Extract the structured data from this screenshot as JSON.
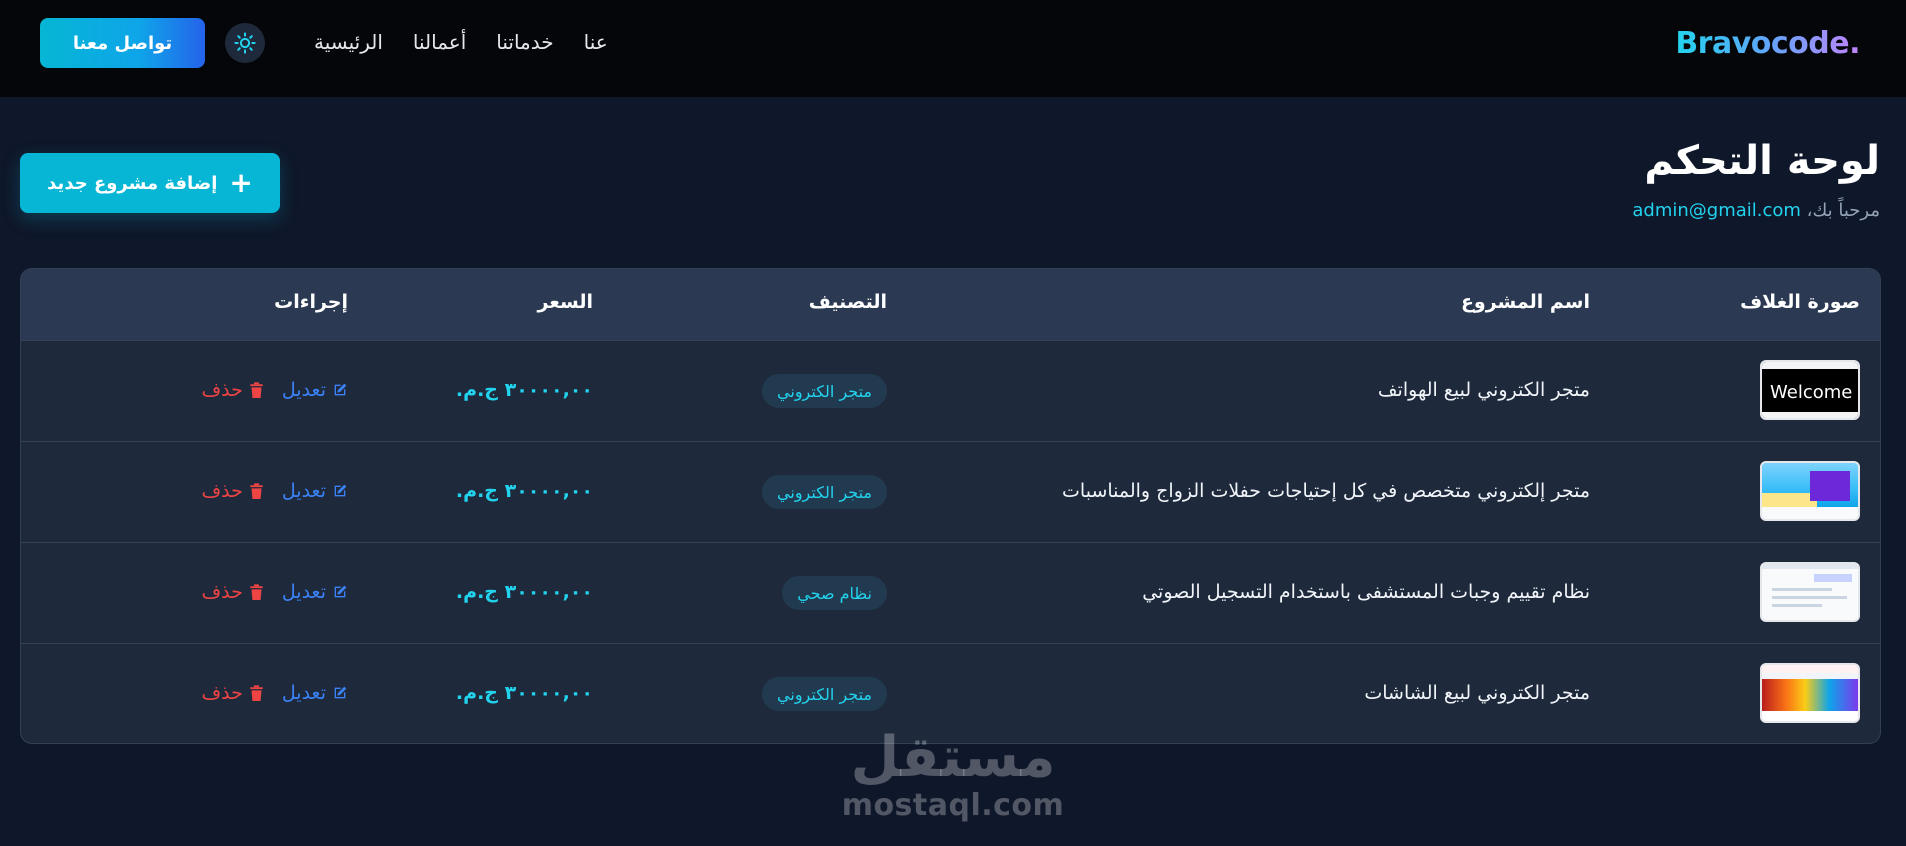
{
  "navbar": {
    "brand": "Bravocode.",
    "links": [
      "الرئيسية",
      "أعمالنا",
      "خدماتنا",
      "عنا"
    ],
    "contact_label": "تواصل معنا",
    "theme_icon": "sun-icon"
  },
  "header": {
    "title": "لوحة التحكم",
    "welcome_prefix": "مرحباً بك،",
    "email": "admin@gmail.com",
    "add_button_label": "إضافة مشروع جديد"
  },
  "table": {
    "columns": [
      "صورة الغلاف",
      "اسم المشروع",
      "التصنيف",
      "السعر",
      "إجراءات"
    ],
    "rows": [
      {
        "name": "متجر الكتروني لبيع الهواتف",
        "category": "متجر الكتروني",
        "price": "٣٠٠٠٠,٠٠ ج.م.",
        "thumb_text": "Welcome"
      },
      {
        "name": "متجر إلكتروني متخصص في كل إحتياجات حفلات الزواج والمناسبات",
        "category": "متجر الكتروني",
        "price": "٣٠٠٠٠,٠٠ ج.م.",
        "thumb_text": ""
      },
      {
        "name": "نظام تقييم وجبات المستشفى باستخدام التسجيل الصوتي",
        "category": "نظام صحي",
        "price": "٣٠٠٠٠,٠٠ ج.م.",
        "thumb_text": ""
      },
      {
        "name": "متجر الكتروني لبيع الشاشات",
        "category": "متجر الكتروني",
        "price": "٣٠٠٠٠,٠٠ ج.م.",
        "thumb_text": ""
      }
    ],
    "edit_label": "تعديل",
    "delete_label": "حذف"
  },
  "watermark": {
    "arabic": "مستقل",
    "latin": "mostaql.com"
  },
  "colors": {
    "accent": "#06b6d4",
    "background": "#0f172a",
    "edit": "#3b82f6",
    "delete": "#ef4444"
  }
}
